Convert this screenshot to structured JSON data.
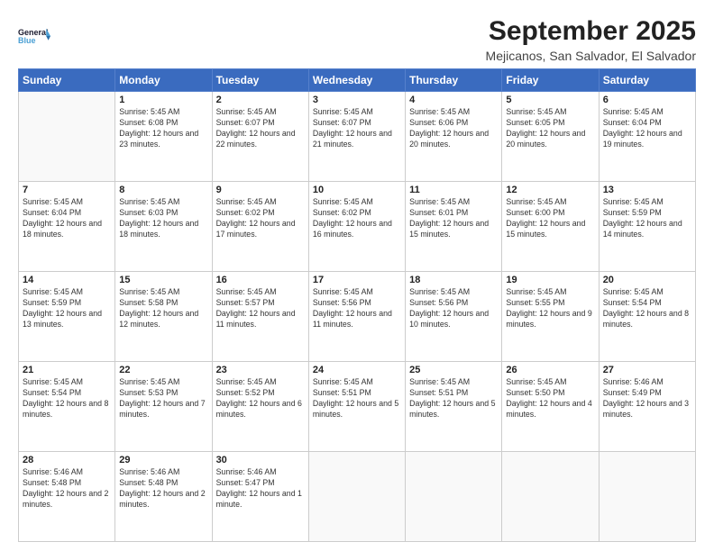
{
  "logo": {
    "line1": "General",
    "line2": "Blue"
  },
  "title": "September 2025",
  "subtitle": "Mejicanos, San Salvador, El Salvador",
  "days_of_week": [
    "Sunday",
    "Monday",
    "Tuesday",
    "Wednesday",
    "Thursday",
    "Friday",
    "Saturday"
  ],
  "weeks": [
    [
      {
        "day": "",
        "empty": true
      },
      {
        "day": "1",
        "sunrise": "5:45 AM",
        "sunset": "6:08 PM",
        "daylight": "12 hours and 23 minutes."
      },
      {
        "day": "2",
        "sunrise": "5:45 AM",
        "sunset": "6:07 PM",
        "daylight": "12 hours and 22 minutes."
      },
      {
        "day": "3",
        "sunrise": "5:45 AM",
        "sunset": "6:07 PM",
        "daylight": "12 hours and 21 minutes."
      },
      {
        "day": "4",
        "sunrise": "5:45 AM",
        "sunset": "6:06 PM",
        "daylight": "12 hours and 20 minutes."
      },
      {
        "day": "5",
        "sunrise": "5:45 AM",
        "sunset": "6:05 PM",
        "daylight": "12 hours and 20 minutes."
      },
      {
        "day": "6",
        "sunrise": "5:45 AM",
        "sunset": "6:04 PM",
        "daylight": "12 hours and 19 minutes."
      }
    ],
    [
      {
        "day": "7",
        "sunrise": "5:45 AM",
        "sunset": "6:04 PM",
        "daylight": "12 hours and 18 minutes."
      },
      {
        "day": "8",
        "sunrise": "5:45 AM",
        "sunset": "6:03 PM",
        "daylight": "12 hours and 18 minutes."
      },
      {
        "day": "9",
        "sunrise": "5:45 AM",
        "sunset": "6:02 PM",
        "daylight": "12 hours and 17 minutes."
      },
      {
        "day": "10",
        "sunrise": "5:45 AM",
        "sunset": "6:02 PM",
        "daylight": "12 hours and 16 minutes."
      },
      {
        "day": "11",
        "sunrise": "5:45 AM",
        "sunset": "6:01 PM",
        "daylight": "12 hours and 15 minutes."
      },
      {
        "day": "12",
        "sunrise": "5:45 AM",
        "sunset": "6:00 PM",
        "daylight": "12 hours and 15 minutes."
      },
      {
        "day": "13",
        "sunrise": "5:45 AM",
        "sunset": "5:59 PM",
        "daylight": "12 hours and 14 minutes."
      }
    ],
    [
      {
        "day": "14",
        "sunrise": "5:45 AM",
        "sunset": "5:59 PM",
        "daylight": "12 hours and 13 minutes."
      },
      {
        "day": "15",
        "sunrise": "5:45 AM",
        "sunset": "5:58 PM",
        "daylight": "12 hours and 12 minutes."
      },
      {
        "day": "16",
        "sunrise": "5:45 AM",
        "sunset": "5:57 PM",
        "daylight": "12 hours and 11 minutes."
      },
      {
        "day": "17",
        "sunrise": "5:45 AM",
        "sunset": "5:56 PM",
        "daylight": "12 hours and 11 minutes."
      },
      {
        "day": "18",
        "sunrise": "5:45 AM",
        "sunset": "5:56 PM",
        "daylight": "12 hours and 10 minutes."
      },
      {
        "day": "19",
        "sunrise": "5:45 AM",
        "sunset": "5:55 PM",
        "daylight": "12 hours and 9 minutes."
      },
      {
        "day": "20",
        "sunrise": "5:45 AM",
        "sunset": "5:54 PM",
        "daylight": "12 hours and 8 minutes."
      }
    ],
    [
      {
        "day": "21",
        "sunrise": "5:45 AM",
        "sunset": "5:54 PM",
        "daylight": "12 hours and 8 minutes."
      },
      {
        "day": "22",
        "sunrise": "5:45 AM",
        "sunset": "5:53 PM",
        "daylight": "12 hours and 7 minutes."
      },
      {
        "day": "23",
        "sunrise": "5:45 AM",
        "sunset": "5:52 PM",
        "daylight": "12 hours and 6 minutes."
      },
      {
        "day": "24",
        "sunrise": "5:45 AM",
        "sunset": "5:51 PM",
        "daylight": "12 hours and 5 minutes."
      },
      {
        "day": "25",
        "sunrise": "5:45 AM",
        "sunset": "5:51 PM",
        "daylight": "12 hours and 5 minutes."
      },
      {
        "day": "26",
        "sunrise": "5:45 AM",
        "sunset": "5:50 PM",
        "daylight": "12 hours and 4 minutes."
      },
      {
        "day": "27",
        "sunrise": "5:46 AM",
        "sunset": "5:49 PM",
        "daylight": "12 hours and 3 minutes."
      }
    ],
    [
      {
        "day": "28",
        "sunrise": "5:46 AM",
        "sunset": "5:48 PM",
        "daylight": "12 hours and 2 minutes."
      },
      {
        "day": "29",
        "sunrise": "5:46 AM",
        "sunset": "5:48 PM",
        "daylight": "12 hours and 2 minutes."
      },
      {
        "day": "30",
        "sunrise": "5:46 AM",
        "sunset": "5:47 PM",
        "daylight": "12 hours and 1 minute."
      },
      {
        "day": "",
        "empty": true
      },
      {
        "day": "",
        "empty": true
      },
      {
        "day": "",
        "empty": true
      },
      {
        "day": "",
        "empty": true
      }
    ]
  ]
}
